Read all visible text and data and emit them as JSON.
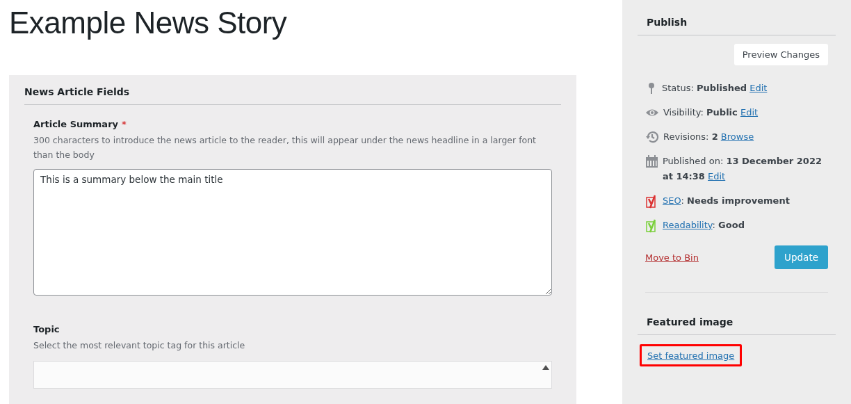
{
  "title": "Example News Story",
  "fields_box": {
    "heading": "News Article Fields",
    "fields": [
      {
        "kind": "textarea",
        "label": "Article Summary",
        "required_mark": "*",
        "description": "300 characters to introduce the news article to the reader, this will appear under the news headline in a larger font than the body",
        "value": "This is a summary below the main title"
      },
      {
        "kind": "list",
        "label": "Topic",
        "description": "Select the most relevant topic tag for this article"
      }
    ]
  },
  "publish": {
    "heading": "Publish",
    "preview_button": "Preview Changes",
    "rows": [
      {
        "kind": "pin",
        "parts": [
          {
            "kind": "text",
            "text": "Status: **Published** "
          },
          {
            "kind": "link",
            "text": "Edit"
          }
        ]
      },
      {
        "kind": "eye",
        "parts": [
          {
            "kind": "text",
            "text": "Visibility: **Public** "
          },
          {
            "kind": "link",
            "text": "Edit"
          }
        ]
      },
      {
        "kind": "history",
        "parts": [
          {
            "kind": "text",
            "text": "Revisions: **2** "
          },
          {
            "kind": "link",
            "text": "Browse"
          }
        ]
      },
      {
        "kind": "calendar",
        "parts": [
          {
            "kind": "text",
            "text": "Published on: **13 December 2022 at 14:38** "
          },
          {
            "kind": "link",
            "text": "Edit"
          }
        ]
      },
      {
        "kind": "yoast",
        "color": "#dc3232",
        "parts": [
          {
            "kind": "link",
            "text": "SEO"
          },
          {
            "kind": "text",
            "text": ": **Needs improvement**"
          }
        ]
      },
      {
        "kind": "yoast",
        "color": "#7ad03a",
        "parts": [
          {
            "kind": "link",
            "text": "Readability"
          },
          {
            "kind": "text",
            "text": ": **Good**"
          }
        ]
      }
    ],
    "delete_link": "Move to Bin",
    "update_button": "Update"
  },
  "featured_image": {
    "heading": "Featured image",
    "link": "Set featured image",
    "highlighted": true
  }
}
